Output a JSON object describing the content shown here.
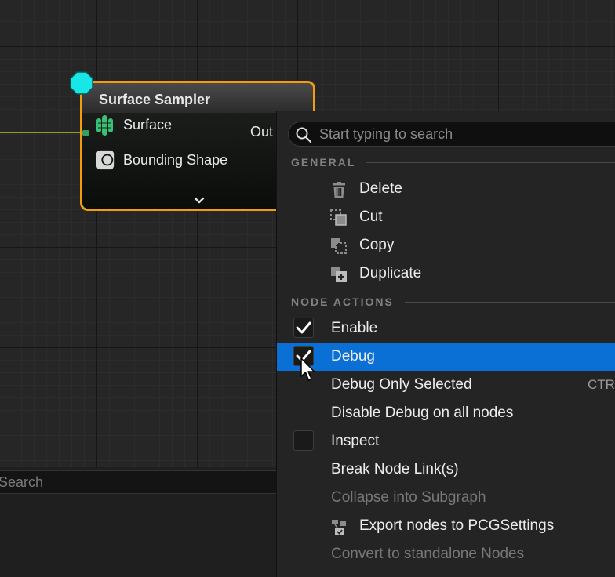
{
  "node": {
    "title": "Surface Sampler",
    "pins": [
      {
        "label": "Surface",
        "icon": "surface-pin-icon"
      },
      {
        "label": "Bounding Shape",
        "icon": "bounding-shape-pin-icon"
      }
    ],
    "output_label": "Out",
    "expand_icon": "chevron-down-icon",
    "colors": {
      "border": "#f29c0f",
      "exec_pin": "#19e6e6",
      "surface_pin": "#3bbf74"
    }
  },
  "bottom_search": {
    "placeholder": "Search"
  },
  "menu": {
    "search_placeholder": "Start typing to search",
    "sections": [
      {
        "label": "GENERAL",
        "items": [
          {
            "label": "Delete",
            "icon": "trash-icon"
          },
          {
            "label": "Cut",
            "icon": "cut-icon"
          },
          {
            "label": "Copy",
            "icon": "copy-icon"
          },
          {
            "label": "Duplicate",
            "icon": "duplicate-icon"
          }
        ]
      },
      {
        "label": "NODE ACTIONS",
        "items": [
          {
            "label": "Enable",
            "checkbox": true,
            "checked": true
          },
          {
            "label": "Debug",
            "checkbox": true,
            "checked": true,
            "highlighted": true
          },
          {
            "label": "Debug Only Selected",
            "shortcut": "CTRL"
          },
          {
            "label": "Disable Debug on all nodes"
          },
          {
            "label": "Inspect",
            "checkbox": true,
            "checked": false
          },
          {
            "label": "Break Node Link(s)"
          },
          {
            "label": "Collapse into Subgraph",
            "disabled": true
          },
          {
            "label": "Export nodes to PCGSettings",
            "icon": "export-icon"
          },
          {
            "label": "Convert to standalone Nodes",
            "disabled": true
          }
        ]
      }
    ],
    "colors": {
      "highlight": "#0b70d6"
    }
  }
}
